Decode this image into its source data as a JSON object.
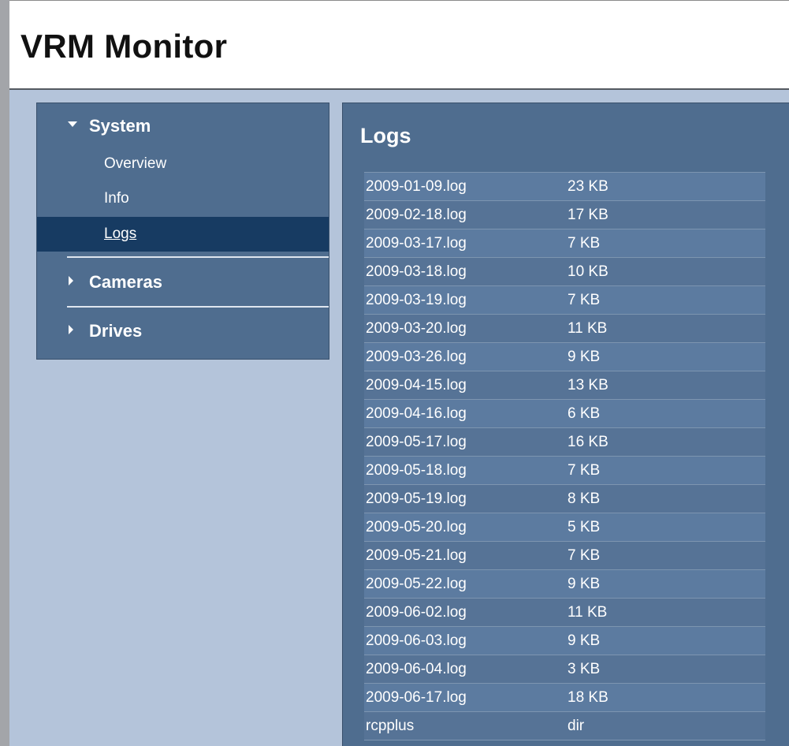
{
  "app": {
    "title": "VRM Monitor"
  },
  "sidebar": {
    "groups": [
      {
        "label": "System",
        "expanded": true,
        "icon": "triangle-down-icon"
      },
      {
        "label": "Cameras",
        "expanded": false,
        "icon": "triangle-right-icon"
      },
      {
        "label": "Drives",
        "expanded": false,
        "icon": "triangle-right-icon"
      }
    ],
    "system_items": [
      {
        "label": "Overview"
      },
      {
        "label": "Info"
      },
      {
        "label": "Logs",
        "active": true
      }
    ]
  },
  "main": {
    "title": "Logs",
    "files": [
      {
        "name": "2009-01-09.log",
        "size": "23 KB"
      },
      {
        "name": "2009-02-18.log",
        "size": "17 KB"
      },
      {
        "name": "2009-03-17.log",
        "size": "7 KB"
      },
      {
        "name": "2009-03-18.log",
        "size": "10 KB"
      },
      {
        "name": "2009-03-19.log",
        "size": "7 KB"
      },
      {
        "name": "2009-03-20.log",
        "size": "11 KB"
      },
      {
        "name": "2009-03-26.log",
        "size": "9 KB"
      },
      {
        "name": "2009-04-15.log",
        "size": "13 KB"
      },
      {
        "name": "2009-04-16.log",
        "size": "6 KB"
      },
      {
        "name": "2009-05-17.log",
        "size": "16 KB"
      },
      {
        "name": "2009-05-18.log",
        "size": "7 KB"
      },
      {
        "name": "2009-05-19.log",
        "size": "8 KB"
      },
      {
        "name": "2009-05-20.log",
        "size": "5 KB"
      },
      {
        "name": "2009-05-21.log",
        "size": "7 KB"
      },
      {
        "name": "2009-05-22.log",
        "size": "9 KB"
      },
      {
        "name": "2009-06-02.log",
        "size": "11 KB"
      },
      {
        "name": "2009-06-03.log",
        "size": "9 KB"
      },
      {
        "name": "2009-06-04.log",
        "size": "3 KB"
      },
      {
        "name": "2009-06-17.log",
        "size": "18 KB"
      },
      {
        "name": "rcpplus",
        "size": "dir"
      }
    ]
  },
  "colors": {
    "page_background": "#b4c4da",
    "panel": "#4f6d8f",
    "active_item": "#173b62"
  }
}
